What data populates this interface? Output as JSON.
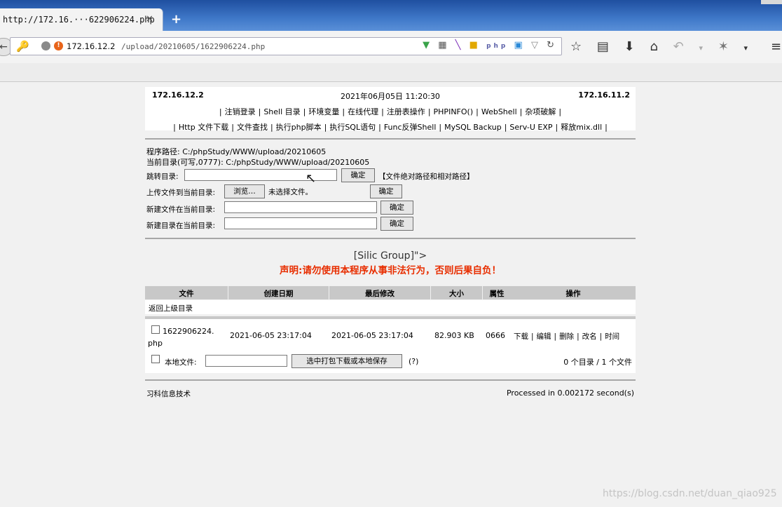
{
  "browser": {
    "tab_title": "http://172.16.···622906224.php",
    "tab_close": "✕",
    "new_tab": "+",
    "url_host": "172.16.12.2",
    "url_path": "/upload/20210605/1622906224.php"
  },
  "header": {
    "ip_left": "172.16.12.2",
    "datetime": "2021年06月05日 11:20:30",
    "ip_right": "172.16.11.2",
    "nav1": [
      "注销登录",
      "Shell 目录",
      "环境变量",
      "在线代理",
      "注册表操作",
      "PHPINFO()",
      "WebShell",
      "杂项破解"
    ],
    "nav2": [
      "Http 文件下载",
      "文件查找",
      "执行php脚本",
      "执行SQL语句",
      "Func反弹Shell",
      "MySQL Backup",
      "Serv-U EXP",
      "释放mix.dll"
    ],
    "sep": "|"
  },
  "paths": {
    "program_path": "程序路径: C:/phpStudy/WWW/upload/20210605",
    "current_dir": "当前目录(可写,0777): C:/phpStudy/WWW/upload/20210605"
  },
  "forms": {
    "jump_label": "跳转目录:",
    "jump_hint": "【文件绝对路径和相对路径】",
    "upload_label": "上传文件到当前目录:",
    "browse_label": "浏览…",
    "no_file": "未选择文件。",
    "newfile_label": "新建文件在当前目录:",
    "newdir_label": "新建目录在当前目录:",
    "confirm": "确定"
  },
  "banner": {
    "slogan": "[Silic Group]\">",
    "warning": "声明:请勿使用本程序从事非法行为，否则后果自负！"
  },
  "table": {
    "headers": [
      "文件",
      "创建日期",
      "最后修改",
      "大小",
      "属性",
      "操作"
    ],
    "up_dir": "返回上级目录",
    "file": {
      "name_line1": "1622906224.",
      "name_line2": "php",
      "created": "2021-06-05 23:17:04",
      "modified": "2021-06-05 23:17:04",
      "size": "82.903 KB",
      "perm": "0666",
      "actions": [
        "下载",
        "编辑",
        "删除",
        "改名",
        "时间"
      ]
    },
    "local_label": "本地文件:",
    "pack_button": "选中打包下载或本地保存",
    "help": "(?)",
    "summary": "0 个目录 / 1 个文件"
  },
  "footer": {
    "left": "习科信息技术",
    "right": "Processed in 0.002172 second(s)"
  },
  "watermark": "https://blog.csdn.net/duan_qiao925"
}
